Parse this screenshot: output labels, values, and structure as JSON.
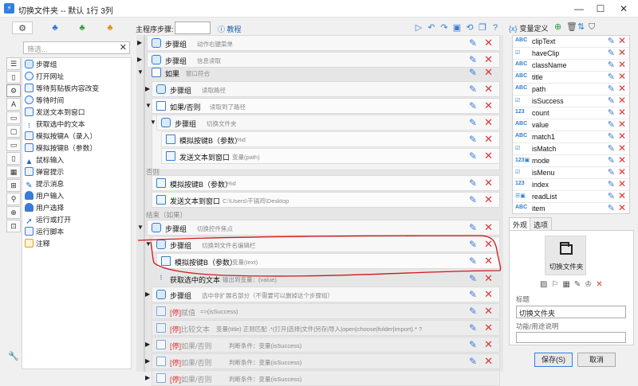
{
  "window": {
    "title": "切换文件夹 -- 默认 1行 3列",
    "minimize": "—",
    "maximize": "☐",
    "close": "✕"
  },
  "left_tabs": [
    "⚙",
    "♣",
    "♣",
    "♣"
  ],
  "search": {
    "placeholder": "筛选...",
    "clear": "✕"
  },
  "side_icons": [
    "☰",
    "▯",
    "⚙",
    "A",
    "▭",
    "▢",
    "▭",
    "▯",
    "▦",
    "⊞",
    "⚲",
    "⊕",
    "⊡"
  ],
  "command_list": [
    {
      "label": "步骤组",
      "icon": "stack-icon"
    },
    {
      "label": "打开网址",
      "icon": "globe-icon"
    },
    {
      "label": "等待剪贴板内容改变",
      "icon": "clipboard-icon"
    },
    {
      "label": "等待时间",
      "icon": "clock-icon"
    },
    {
      "label": "发送文本到窗口",
      "icon": "window-icon"
    },
    {
      "label": "获取选中的文本",
      "icon": "cursor-icon"
    },
    {
      "label": "模拟按键A（录入）",
      "icon": "keyboard-icon"
    },
    {
      "label": "模拟按键B（参数）",
      "icon": "keyboard-icon"
    },
    {
      "label": "鼠标输入",
      "icon": "mouse-icon"
    },
    {
      "label": "弹窗提示",
      "icon": "popup-icon"
    },
    {
      "label": "提示消息",
      "icon": "message-icon"
    },
    {
      "label": "用户输入",
      "icon": "person-icon"
    },
    {
      "label": "用户选择",
      "icon": "person-icon"
    },
    {
      "label": "运行或打开",
      "icon": "run-icon"
    },
    {
      "label": "运行脚本",
      "icon": "script-icon"
    },
    {
      "label": "注释",
      "icon": "note-icon"
    }
  ],
  "toolbar": {
    "main_step_label": "主程序步骤:",
    "main_step_value": "",
    "help": "教程"
  },
  "flow": {
    "rows": [
      {
        "title": "步骤组",
        "desc": "动作右键菜单"
      },
      {
        "title": "步骤组",
        "desc": "信息读取"
      },
      {
        "title": "如果",
        "desc": "窗口符合"
      },
      {
        "title": "步骤组",
        "desc": "读取路径"
      },
      {
        "title": "如果/否则",
        "desc": "读取到了路径"
      },
      {
        "title": "步骤组",
        "desc": "切换文件夹"
      },
      {
        "title": "模拟按键B（参数）",
        "desc": "%d"
      },
      {
        "title": "发送文本到窗口",
        "desc": "变量(path)"
      },
      {
        "title": "模拟按键B（参数）",
        "desc": "%d"
      },
      {
        "title": "发送文本到窗口",
        "desc": "C:\\Users\\干锅鸡\\Desktop"
      },
      {
        "title": "步骤组",
        "desc": "切换控件焦点"
      },
      {
        "title": "步骤组",
        "desc": "切换到文件名编辑栏"
      },
      {
        "title": "模拟按键B（参数）",
        "desc": "变量(text)"
      },
      {
        "title": "获取选中的文本",
        "desc": "输出到变量：(value)"
      },
      {
        "title": "步骤组",
        "desc": "选中非扩展名部分（不需要可以删掉这个步骤组）"
      },
      {
        "prefix": "[停]",
        "title": "赋值",
        "desc": "=>(isSuccess)"
      },
      {
        "prefix": "[停]",
        "title": "比较文本",
        "desc": "变量(title) 正则匹配 .*(打开|选择|文件|另存|导入|open|choose|folder|import).* ?"
      },
      {
        "prefix": "[停]",
        "title": "如果/否则",
        "desc": "判断条件：变量(isSuccess)"
      },
      {
        "prefix": "[停]",
        "title": "如果/否则",
        "desc": "判断条件：变量(isSuccess)"
      },
      {
        "prefix": "[停]",
        "title": "如果/否则",
        "desc": "判断条件：变量(isSuccess)"
      }
    ],
    "else_label": "否则",
    "end_label": "结束（如果）"
  },
  "variables": {
    "title": "变量定义",
    "title_icon": "{x}",
    "items": [
      {
        "type": "ABC",
        "name": "clipText"
      },
      {
        "type": "☑",
        "name": "haveClip"
      },
      {
        "type": "ABC",
        "name": "className"
      },
      {
        "type": "ABC",
        "name": "title"
      },
      {
        "type": "ABC",
        "name": "path"
      },
      {
        "type": "☑",
        "name": "isSuccess"
      },
      {
        "type": "123",
        "name": "count"
      },
      {
        "type": "ABC",
        "name": "value"
      },
      {
        "type": "ABC",
        "name": "match1"
      },
      {
        "type": "☑",
        "name": "isMatch"
      },
      {
        "type": "123▣",
        "name": "mode"
      },
      {
        "type": "☑",
        "name": "isMenu"
      },
      {
        "type": "123",
        "name": "index"
      },
      {
        "type": "☰▣",
        "name": "readList"
      },
      {
        "type": "ABC",
        "name": "item"
      }
    ]
  },
  "props": {
    "tab_appearance": "外观",
    "tab_options": "选项",
    "icon_label": "切换文件夹",
    "title_label": "标题",
    "title_value": "切换文件夹",
    "desc_label": "功能/用途说明",
    "desc_value": ""
  },
  "buttons": {
    "save": "保存(S)",
    "cancel": "取消"
  },
  "colors": {
    "accent": "#2f7fd2",
    "danger": "#d33333",
    "annotation": "#d01818"
  }
}
